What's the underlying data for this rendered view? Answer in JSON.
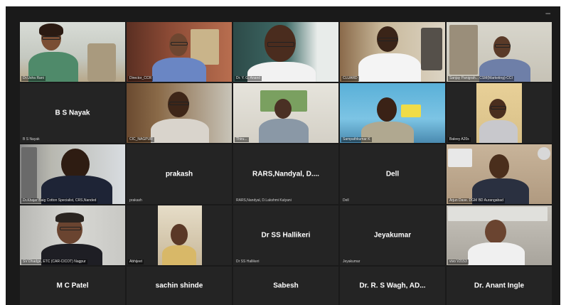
{
  "meeting": {
    "window_control": "–",
    "tiles": [
      {
        "caption": "Dr.Usha Rani"
      },
      {
        "caption": "Director_CCR"
      },
      {
        "caption": "Dr. Y. G. Anand"
      },
      {
        "caption": "CLUARD"
      },
      {
        "caption": "Sanjay Panigrah... CSM(Marketing)-CCI"
      },
      {
        "name": "B S Nayak",
        "caption": "B S Nayak"
      },
      {
        "caption": "CIC_NAGPUR"
      },
      {
        "caption": "Thiru..."
      },
      {
        "caption": "Sampathkumar K"
      },
      {
        "caption": "Baleey A20s"
      },
      {
        "caption": "Dr.Khojer Baig Cotton Specialist, CRS,Nanded"
      },
      {
        "name": "prakash",
        "caption": "prakash"
      },
      {
        "name": "RARS,Nandyal,  D....",
        "caption": "RARS,Nandyal, D.Lakshmi  Kalyani"
      },
      {
        "name": "Dell",
        "caption": "Dell"
      },
      {
        "caption": "Arjun Dave.  DGM BD Aurangabad"
      },
      {
        "caption": "SV Dhadge, ETC (CAR-CICOT) Nagpur"
      },
      {
        "caption": "Abhijeet"
      },
      {
        "name": "Dr SS Hallikeri",
        "caption": "Dr SS Hallikeri"
      },
      {
        "name": "Jeyakumar",
        "caption": "Jeyakumar"
      },
      {
        "caption": "vivo V2153"
      },
      {
        "name": "M C Patel"
      },
      {
        "name": "sachin shinde"
      },
      {
        "name": "Sabesh"
      },
      {
        "name": "Dr. R. S Wagh, AD..."
      },
      {
        "name": "Dr. Anant Ingle"
      }
    ]
  }
}
